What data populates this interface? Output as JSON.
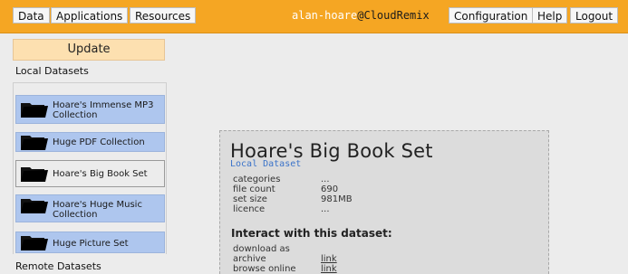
{
  "nav": {
    "tabs": [
      {
        "label": "Data"
      },
      {
        "label": "Applications"
      },
      {
        "label": "Resources"
      }
    ],
    "user": {
      "name": "alan-hoare",
      "host": "@CloudRemix"
    },
    "right_tabs": [
      {
        "label": "Configuration"
      },
      {
        "label": "Help"
      },
      {
        "label": "Logout"
      }
    ]
  },
  "sidebar": {
    "update_label": "Update",
    "local_title": "Local Datasets",
    "remote_title": "Remote Datasets",
    "datasets": [
      {
        "label": "Hoare's Immense MP3 Collection"
      },
      {
        "label": "Huge PDF Collection"
      },
      {
        "label": "Hoare's Big Book Set"
      },
      {
        "label": "Hoare's Huge Music Collection"
      },
      {
        "label": "Huge Picture Set"
      }
    ]
  },
  "detail": {
    "title": "Hoare's Big Book Set",
    "subtitle": "Local Dataset",
    "meta": [
      {
        "key": "categories",
        "value": "..."
      },
      {
        "key": "file count",
        "value": "690"
      },
      {
        "key": "set size",
        "value": "981MB"
      },
      {
        "key": "licence",
        "value": "..."
      }
    ],
    "interact_heading": "Interact with this dataset:",
    "actions": [
      {
        "key": "download as",
        "value": ""
      },
      {
        "key": "archive",
        "value": "link"
      },
      {
        "key": "browse online",
        "value": "link"
      }
    ]
  },
  "colors": {
    "topbar": "#f5a623",
    "update_button": "#fde0b0",
    "dataset_item": "#aec6ee",
    "subtitle": "#3b73c9"
  },
  "icons": {
    "dataset": "folder-icon"
  }
}
